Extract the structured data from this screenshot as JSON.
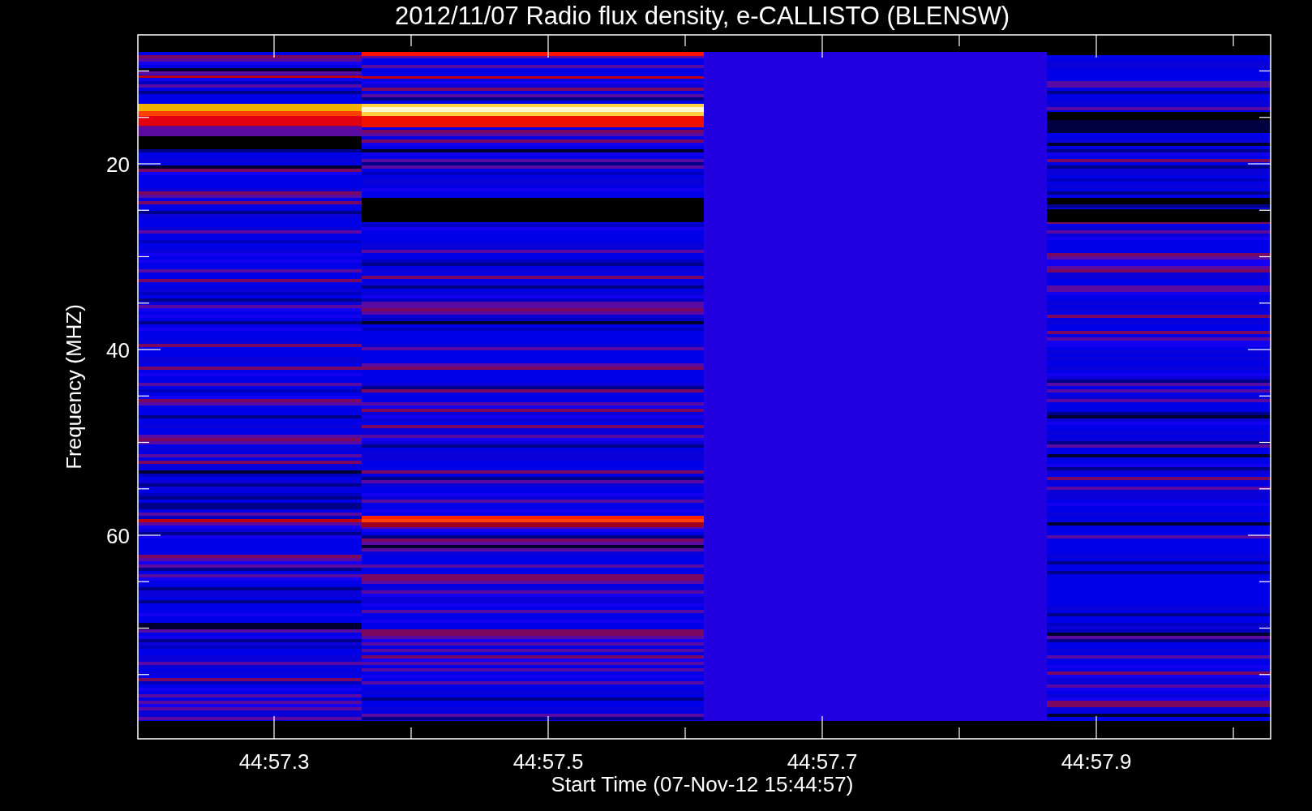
{
  "title": "2012/11/07  Radio flux density, e-CALLISTO (BLENSW)",
  "y_axis": {
    "label": "Frequency (MHZ)",
    "ticks": [
      "20",
      "40",
      "60"
    ]
  },
  "x_axis": {
    "label": "Start Time (07-Nov-12 15:44:57)",
    "ticks": [
      "44:57.3",
      "44:57.5",
      "44:57.7",
      "44:57.9"
    ]
  }
}
